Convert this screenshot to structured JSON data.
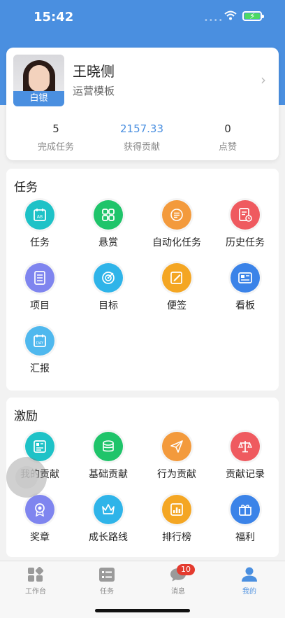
{
  "status_bar": {
    "time": "15:42",
    "signal": "••••"
  },
  "profile": {
    "name": "王晓侧",
    "role": "运营模板",
    "badge": "白银",
    "stats": [
      {
        "value": "5",
        "label": "完成任务"
      },
      {
        "value": "2157.33",
        "label": "获得贡献"
      },
      {
        "value": "0",
        "label": "点赞"
      }
    ]
  },
  "tasks_section": {
    "title": "任务",
    "items": [
      {
        "label": "任务",
        "icon": "calendar-icon",
        "color": "#1ec2c7"
      },
      {
        "label": "悬赏",
        "icon": "grid-icon",
        "color": "#1fc46a"
      },
      {
        "label": "自动化任务",
        "icon": "auto-list-icon",
        "color": "#f39a3c"
      },
      {
        "label": "历史任务",
        "icon": "history-doc-icon",
        "color": "#ef5a5f"
      },
      {
        "label": "项目",
        "icon": "list-doc-icon",
        "color": "#7f85ef"
      },
      {
        "label": "目标",
        "icon": "target-icon",
        "color": "#2fb4e9"
      },
      {
        "label": "便签",
        "icon": "note-icon",
        "color": "#f4a623"
      },
      {
        "label": "看板",
        "icon": "board-icon",
        "color": "#3b83e8"
      },
      {
        "label": "汇报",
        "icon": "report-day-icon",
        "color": "#4fb8ee"
      }
    ]
  },
  "incentive_section": {
    "title": "激励",
    "items": [
      {
        "label": "我的贡献",
        "icon": "contribution-icon",
        "color": "#1ec2c7"
      },
      {
        "label": "基础贡献",
        "icon": "coins-icon",
        "color": "#1fc46a"
      },
      {
        "label": "行为贡献",
        "icon": "paper-plane-icon",
        "color": "#f39a3c"
      },
      {
        "label": "贡献记录",
        "icon": "scale-icon",
        "color": "#ef5a5f"
      },
      {
        "label": "奖章",
        "icon": "medal-icon",
        "color": "#7f85ef"
      },
      {
        "label": "成长路线",
        "icon": "crown-icon",
        "color": "#2fb4e9"
      },
      {
        "label": "排行榜",
        "icon": "ranking-icon",
        "color": "#f4a623"
      },
      {
        "label": "福利",
        "icon": "gift-icon",
        "color": "#3b83e8"
      }
    ]
  },
  "tabbar": {
    "tabs": [
      {
        "label": "工作台",
        "icon": "workbench-icon"
      },
      {
        "label": "任务",
        "icon": "task-list-icon"
      },
      {
        "label": "消息",
        "icon": "message-icon",
        "badge": "10"
      },
      {
        "label": "我的",
        "icon": "person-icon",
        "active": true
      }
    ]
  },
  "colors": {
    "brand": "#4a8fe0",
    "badge_red": "#e43b2f"
  }
}
